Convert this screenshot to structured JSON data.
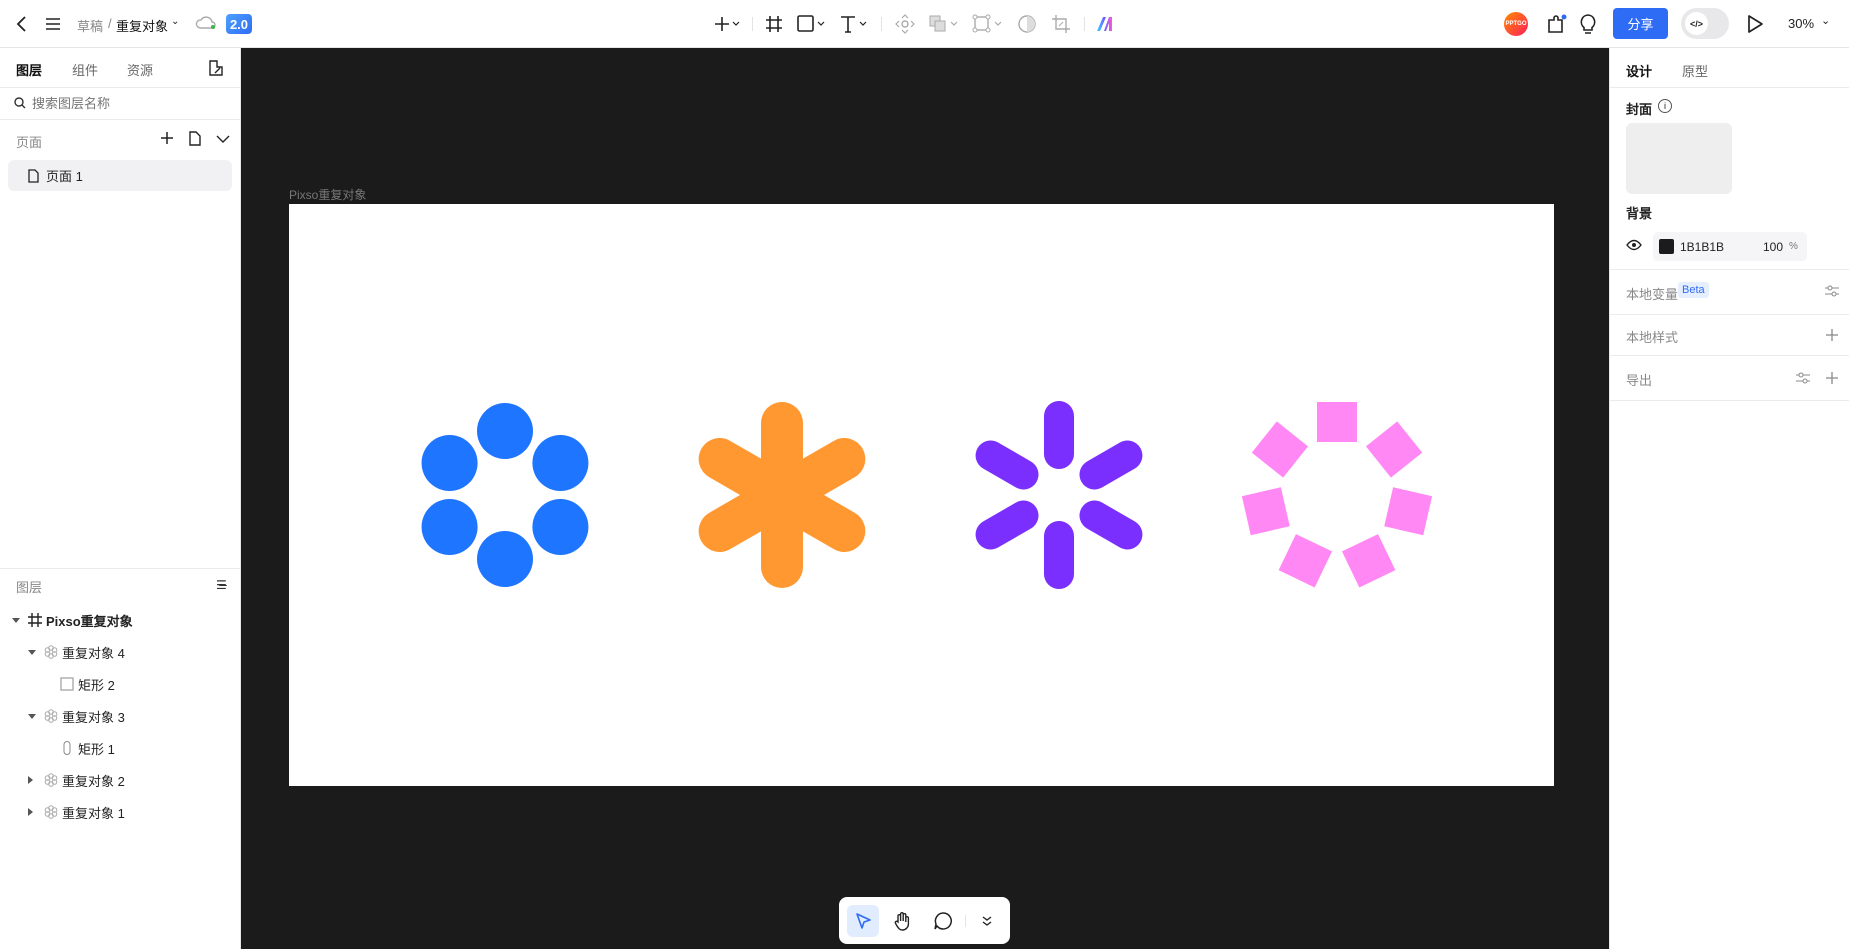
{
  "topbar": {
    "breadcrumb_parent": "草稿",
    "breadcrumb_sep": "/",
    "file_name": "重复对象",
    "version_badge": "2.0",
    "avatar_text": "PPTGO",
    "share_label": "分享",
    "zoom": "30%",
    "tools": [
      "plus-icon",
      "frame-icon",
      "rectangle-icon",
      "text-icon",
      "component-icon",
      "boolean-icon",
      "vector-icon",
      "mask-icon",
      "crop-icon",
      "ai-logo-icon"
    ]
  },
  "left": {
    "tabs": [
      "图层",
      "组件",
      "资源"
    ],
    "search_placeholder": "搜索图层名称",
    "pages_label": "页面",
    "pages": [
      "页面 1"
    ],
    "layers_label": "图层",
    "layers": [
      {
        "name": "Pixso重复对象",
        "type": "frame",
        "level": 0,
        "expanded": true
      },
      {
        "name": "重复对象 4",
        "type": "repeat",
        "level": 1,
        "expanded": true
      },
      {
        "name": "矩形 2",
        "type": "rect",
        "level": 2
      },
      {
        "name": "重复对象 3",
        "type": "repeat",
        "level": 1,
        "expanded": true
      },
      {
        "name": "矩形 1",
        "type": "pill",
        "level": 2
      },
      {
        "name": "重复对象 2",
        "type": "repeat",
        "level": 1,
        "expanded": false
      },
      {
        "name": "重复对象 1",
        "type": "repeat",
        "level": 1,
        "expanded": false
      }
    ]
  },
  "canvas": {
    "frame_label": "Pixso重复对象",
    "colors": {
      "blue": "#1E75FF",
      "orange": "#FF9830",
      "purple": "#7B2FFF",
      "pink": "#FF88F5"
    },
    "background": "#1B1B1B"
  },
  "right": {
    "tabs": [
      "设计",
      "原型"
    ],
    "cover_label": "封面",
    "bg_label": "背景",
    "bg_hex": "1B1B1B",
    "bg_opacity": "100",
    "bg_pct": "%",
    "local_vars": "本地变量",
    "beta": "Beta",
    "local_styles": "本地样式",
    "export": "导出"
  },
  "bottom": {
    "tools": [
      "move-tool",
      "hand-tool",
      "comment-tool",
      "more-tools"
    ]
  },
  "help": "?"
}
